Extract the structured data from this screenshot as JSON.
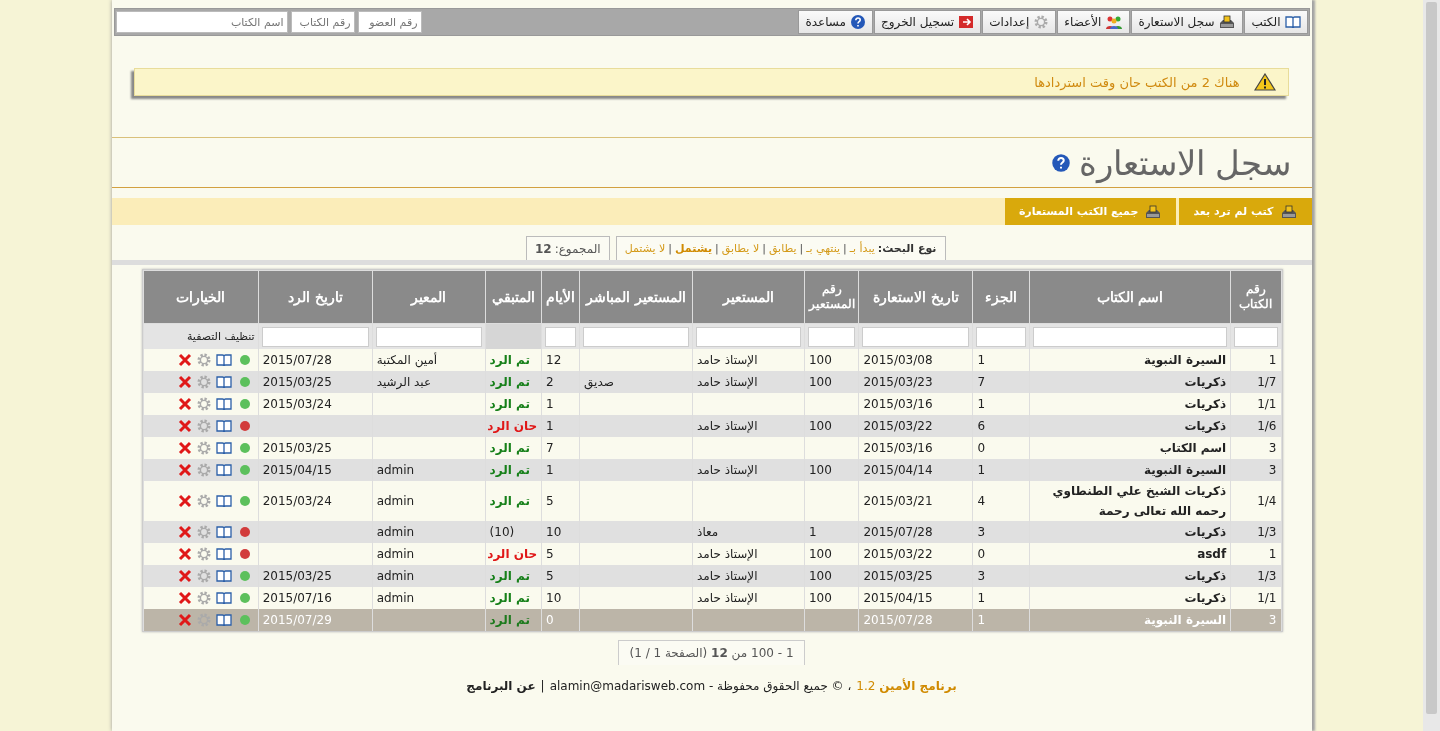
{
  "nav": {
    "items": [
      {
        "label": "الكتب",
        "kind": "book"
      },
      {
        "label": "سجل الاستعارة",
        "kind": "tray"
      },
      {
        "label": "الأعضاء",
        "kind": "people"
      },
      {
        "label": "إعدادات",
        "kind": "gear"
      },
      {
        "label": "تسجيل الخروج",
        "kind": "exit"
      },
      {
        "label": "مساعدة",
        "kind": "help"
      }
    ],
    "search_fields": [
      {
        "placeholder": "رقم العضو"
      },
      {
        "placeholder": "رقم الكتاب"
      },
      {
        "placeholder": "اسم الكتاب"
      }
    ]
  },
  "alert": {
    "text": "هناك 2 من الكتب حان وقت استردادها"
  },
  "page_title": "سجل الاستعارة",
  "toolbar": {
    "buttons": [
      "كتب لم ترد بعد",
      "جميع الكتب المستعارة"
    ]
  },
  "search_type": {
    "label": "نوع البحث:",
    "options": [
      {
        "label": "يبدأ بـ",
        "selected": false
      },
      {
        "label": "ينتهي بـ",
        "selected": false
      },
      {
        "label": "يطابق",
        "selected": false
      },
      {
        "label": "لا يطابق",
        "selected": false
      },
      {
        "label": "يشتمل",
        "selected": true
      },
      {
        "label": "لا يشتمل",
        "selected": false
      }
    ],
    "separators": [
      "|",
      "|",
      "|",
      "|",
      "|"
    ],
    "total": "المجموع: **12**"
  },
  "table": {
    "columns": [
      "رقم الكتاب",
      "اسم الكتاب",
      "الجزء",
      "تاريخ الاستعارة",
      "رقم المستعير",
      "المستعير",
      "المستعير المباشر",
      "الأيام",
      "المتبقي",
      "المعير",
      "تاريخ الرد",
      "الخيارات"
    ],
    "clear_filter": "تنظيف التصفية",
    "rows": [
      {
        "cells": [
          "1",
          "السيرة النبوية",
          "1",
          "2015/03/08",
          "100",
          "الإستاذ حامد",
          "",
          "12",
          "تم الرد",
          "أمين المكتبة",
          "2015/07/28"
        ],
        "kind": "returned",
        "color": "#5cc05c",
        "selected": false
      },
      {
        "cells": [
          "1/7",
          "ذكريات",
          "7",
          "2015/03/23",
          "100",
          "الإستاذ حامد",
          "صديق",
          "2",
          "تم الرد",
          "عبد الرشيد",
          "2015/03/25"
        ],
        "kind": "returned",
        "color": "#5cc05c",
        "selected": false
      },
      {
        "cells": [
          "1/1",
          "ذكريات",
          "1",
          "2015/03/16",
          "",
          "",
          "",
          "1",
          "تم الرد",
          "",
          "2015/03/24"
        ],
        "kind": "returned",
        "color": "#5cc05c",
        "selected": false
      },
      {
        "cells": [
          "1/6",
          "ذكريات",
          "6",
          "2015/03/22",
          "100",
          "الإستاذ حامد",
          "",
          "1",
          "حان الرد",
          "",
          ""
        ],
        "kind": "due",
        "color": "#d23c3c",
        "selected": false
      },
      {
        "cells": [
          "3",
          "اسم الكتاب",
          "0",
          "2015/03/16",
          "",
          "",
          "",
          "7",
          "تم الرد",
          "",
          "2015/03/25"
        ],
        "kind": "returned",
        "color": "#5cc05c",
        "selected": false
      },
      {
        "cells": [
          "3",
          "السيرة النبوية",
          "1",
          "2015/04/14",
          "100",
          "الإستاذ حامد",
          "",
          "1",
          "تم الرد",
          "admin",
          "2015/04/15"
        ],
        "kind": "returned",
        "color": "#5cc05c",
        "selected": false
      },
      {
        "cells": [
          "1/4",
          "ذكريات الشيخ علي الطنطاوي رحمه الله تعالى رحمة",
          "4",
          "2015/03/21",
          "",
          "",
          "",
          "5",
          "تم الرد",
          "admin",
          "2015/03/24"
        ],
        "kind": "returned",
        "color": "#5cc05c",
        "selected": false
      },
      {
        "cells": [
          "1/3",
          "ذكريات",
          "3",
          "2015/07/28",
          "1",
          "معاذ",
          "",
          "10",
          "(10)",
          "admin",
          ""
        ],
        "kind": "plain",
        "color": "#d23c3c",
        "selected": false
      },
      {
        "cells": [
          "1",
          "asdf",
          "0",
          "2015/03/22",
          "100",
          "الإستاذ حامد",
          "",
          "5",
          "حان الرد",
          "admin",
          ""
        ],
        "kind": "due",
        "color": "#d23c3c",
        "selected": false
      },
      {
        "cells": [
          "1/3",
          "ذكريات",
          "3",
          "2015/03/25",
          "100",
          "الإستاذ حامد",
          "",
          "5",
          "تم الرد",
          "admin",
          "2015/03/25"
        ],
        "kind": "returned",
        "color": "#5cc05c",
        "selected": false
      },
      {
        "cells": [
          "1/1",
          "ذكريات",
          "1",
          "2015/04/15",
          "100",
          "الإستاذ حامد",
          "",
          "10",
          "تم الرد",
          "admin",
          "2015/07/16"
        ],
        "kind": "returned",
        "color": "#5cc05c",
        "selected": false
      },
      {
        "cells": [
          "3",
          "السيرة النبوية",
          "1",
          "2015/07/28",
          "",
          "",
          "",
          "0",
          "تم الرد",
          "",
          "2015/07/29"
        ],
        "kind": "returned",
        "color": "#5cc05c",
        "selected": true
      }
    ]
  },
  "pager": "1 - 100 من **12** (الصفحة 1 / 1)",
  "footer": {
    "product": "**برنامج الأمين** 1.2",
    "copyright": "، © جميع الحقوق محفوظة - alamin@madarisweb.com",
    "separator": "|",
    "about": "عن البرنامج"
  }
}
